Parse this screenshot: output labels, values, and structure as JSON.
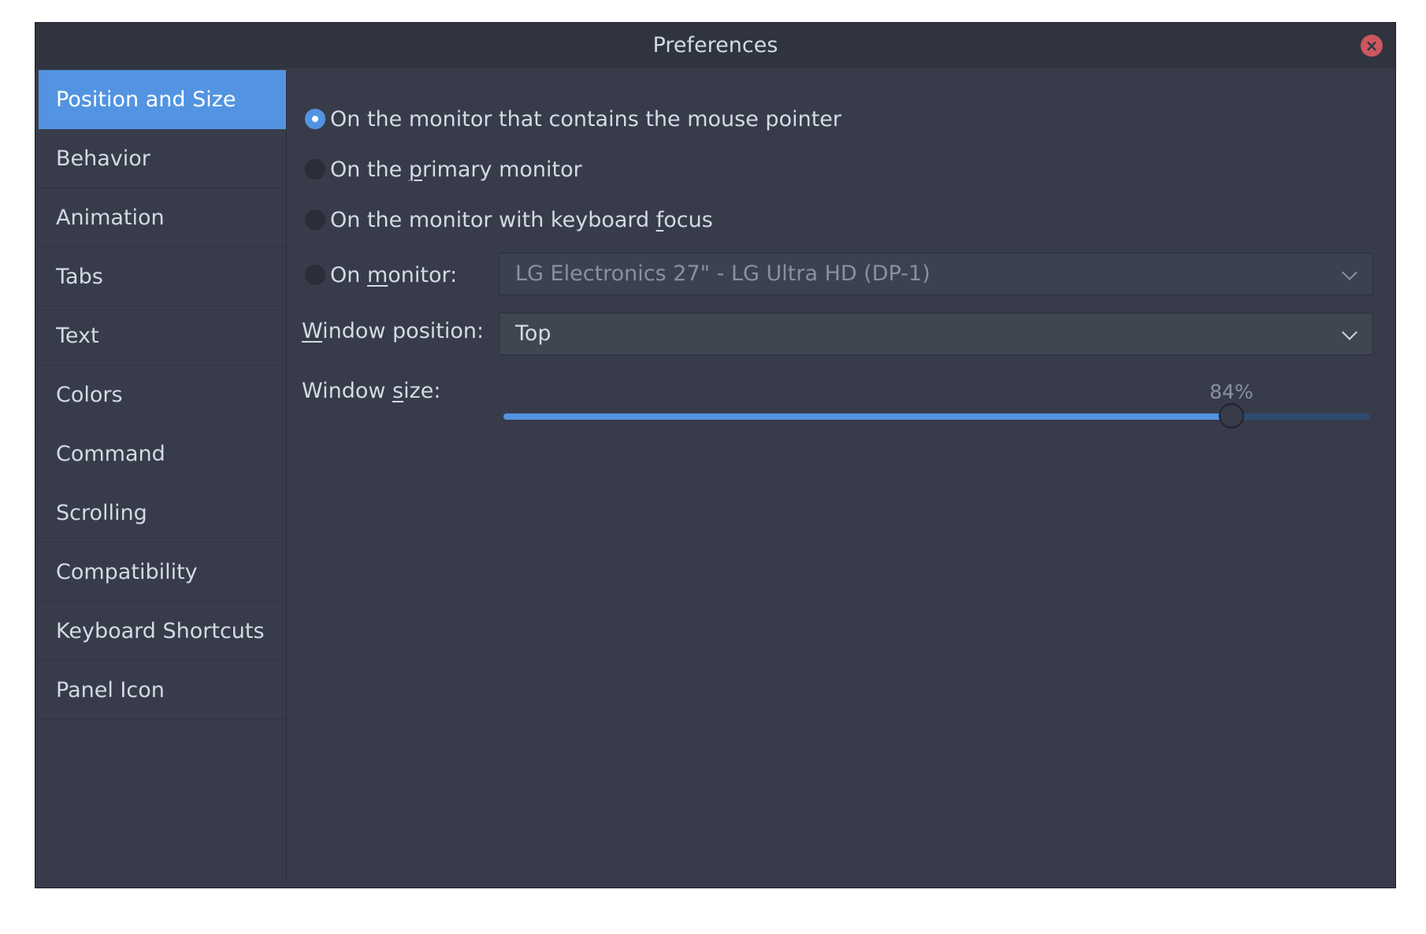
{
  "window": {
    "title": "Preferences"
  },
  "sidebar": {
    "items": [
      {
        "label": "Position and Size",
        "selected": true
      },
      {
        "label": "Behavior"
      },
      {
        "label": "Animation"
      },
      {
        "label": "Tabs"
      },
      {
        "label": "Text"
      },
      {
        "label": "Colors"
      },
      {
        "label": "Command"
      },
      {
        "label": "Scrolling"
      },
      {
        "label": "Compatibility"
      },
      {
        "label": "Keyboard Shortcuts"
      },
      {
        "label": "Panel Icon"
      }
    ]
  },
  "monitor": {
    "options": [
      {
        "pre": "On the monitor that contains the mouse pointer",
        "mnemonic": "",
        "post": "",
        "checked": true
      },
      {
        "pre": "On the ",
        "mnemonic": "p",
        "post": "rimary monitor",
        "checked": false
      },
      {
        "pre": "On the monitor with keyboard ",
        "mnemonic": "f",
        "post": "ocus",
        "checked": false
      },
      {
        "pre": "On ",
        "mnemonic": "m",
        "post": "onitor:",
        "checked": false
      }
    ],
    "selected_monitor": "LG Electronics 27\" - LG Ultra HD (DP-1)"
  },
  "window_position": {
    "label_mnemonic": "W",
    "label_rest": "indow position:",
    "value": "Top"
  },
  "window_size": {
    "label_pre": "Window ",
    "label_mnemonic": "s",
    "label_post": "ize:",
    "value": 84,
    "value_label": "84%"
  },
  "colors": {
    "accent": "#5294e2",
    "close": "#cc575d",
    "background": "#383c4a",
    "titlebar": "#2f343f"
  },
  "icons": {
    "close": "close-icon",
    "dropdown": "chevron-down-icon"
  }
}
